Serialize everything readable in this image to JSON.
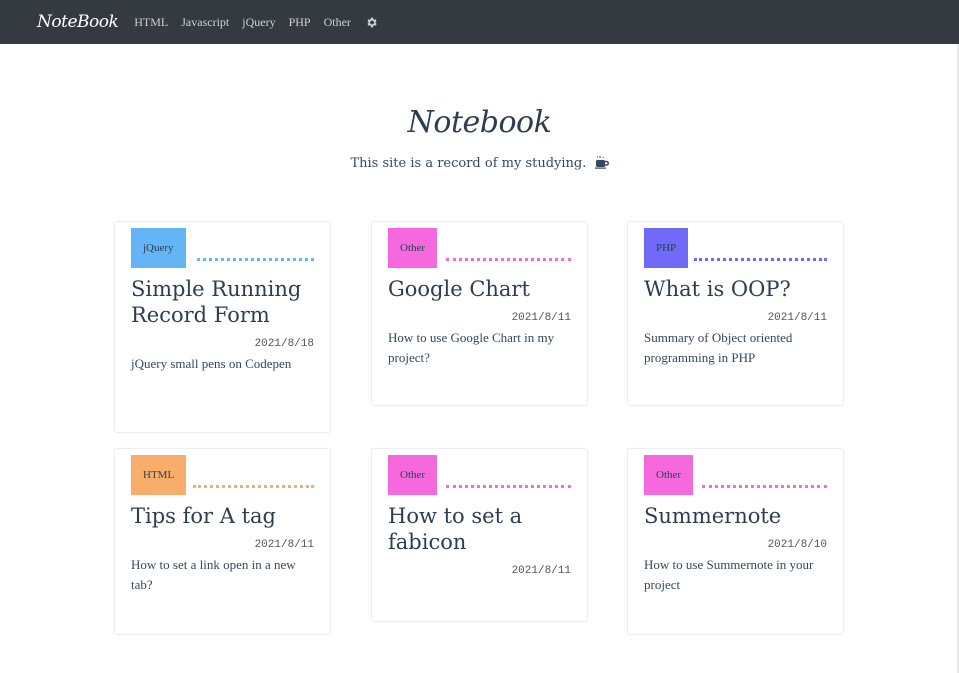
{
  "navbar": {
    "brand": "NoteBook",
    "links": [
      "HTML",
      "Javascript",
      "jQuery",
      "PHP",
      "Other"
    ],
    "settings_icon": "gear-icon"
  },
  "hero": {
    "title": "Notebook",
    "subtitle": "This site is a record of my studying.",
    "icon": "coffee-mug-icon"
  },
  "colors": {
    "jquery": "#64b5f6",
    "other": "#f668dd",
    "php": "#6f6af8",
    "html": "#f8ad6a"
  },
  "cards": [
    {
      "tag": "jQuery",
      "title": "Simple Running Record Form",
      "date": "2021/8/18",
      "desc": "jQuery small pens on Codepen"
    },
    {
      "tag": "Other",
      "title": "Google Chart",
      "date": "2021/8/11",
      "desc": "How to use Google Chart in my project?"
    },
    {
      "tag": "PHP",
      "title": "What is OOP?",
      "date": "2021/8/11",
      "desc": "Summary of Object oriented programming in PHP"
    },
    {
      "tag": "HTML",
      "title": "Tips for A tag",
      "date": "2021/8/11",
      "desc": "How to set a link open in a new tab?"
    },
    {
      "tag": "Other",
      "title": "How to set a fabicon",
      "date": "2021/8/11",
      "desc": ""
    },
    {
      "tag": "Other",
      "title": "Summernote",
      "date": "2021/8/10",
      "desc": "How to use Summernote in your project"
    }
  ]
}
